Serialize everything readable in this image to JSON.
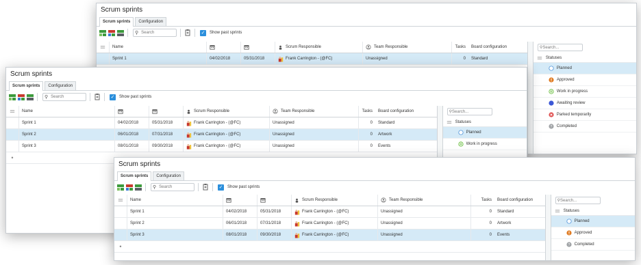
{
  "title": "Scrum sprints",
  "tabs": [
    "Scrum sprints",
    "Configuration"
  ],
  "search_placeholder": "Search",
  "show_past_label": "Show past sprints",
  "columns": {
    "name": "Name",
    "scrum_responsible": "Scrum Responsible",
    "team_responsible": "Team Responsible",
    "tasks": "Tasks",
    "board_configuration": "Board configuration"
  },
  "side": {
    "search_placeholder": "Search...",
    "header": "Statuses"
  },
  "colors": {
    "accent": "#2b8fdc",
    "selection": "#d5eaf7",
    "planned": "#ffffff",
    "approved": "#e07b22",
    "work_in_progress": "#5cb82e",
    "awaiting_review": "#3b57d6",
    "parked_temporarily": "#e05454",
    "completed": "#a0a3a6"
  },
  "windows": [
    {
      "rows": [
        {
          "name": "Sprint 1",
          "start": "04/02/2018",
          "end": "05/31/2018",
          "scrum": "Frank Carrington - (@FC)",
          "team": "Unassigned",
          "tasks": "0",
          "board": "Standard",
          "selected": true
        }
      ],
      "statuses": [
        {
          "label": "Planned",
          "icon": "circle-outline-icon",
          "color": "#ffffff",
          "selected": true
        },
        {
          "label": "Approved",
          "icon": "exclamation-icon",
          "color": "#e07b22"
        },
        {
          "label": "Work in progress",
          "icon": "pause-icon",
          "color": "#5cb82e"
        },
        {
          "label": "Awaiting review",
          "icon": "dot-icon",
          "color": "#3b57d6"
        },
        {
          "label": "Parked temporarily",
          "icon": "cross-icon",
          "color": "#e05454"
        },
        {
          "label": "Completed",
          "icon": "question-icon",
          "color": "#a0a3a6"
        }
      ]
    },
    {
      "rows": [
        {
          "name": "Sprint 1",
          "start": "04/02/2018",
          "end": "05/31/2018",
          "scrum": "Frank Carrington - (@FC)",
          "team": "Unassigned",
          "tasks": "0",
          "board": "Standard"
        },
        {
          "name": "Sprint 2",
          "start": "06/01/2018",
          "end": "07/31/2018",
          "scrum": "Frank Carrington - (@FC)",
          "team": "Unassigned",
          "tasks": "0",
          "board": "Artwork",
          "selected": true
        },
        {
          "name": "Sprint 3",
          "start": "08/01/2018",
          "end": "09/30/2018",
          "scrum": "Frank Carrington - (@FC)",
          "team": "Unassigned",
          "tasks": "0",
          "board": "Events"
        }
      ],
      "statuses": [
        {
          "label": "Planned",
          "icon": "circle-outline-icon",
          "color": "#ffffff",
          "selected": true
        },
        {
          "label": "Work in progress",
          "icon": "pause-icon",
          "color": "#5cb82e"
        }
      ]
    },
    {
      "rows": [
        {
          "name": "Sprint 1",
          "start": "04/02/2018",
          "end": "05/31/2018",
          "scrum": "Frank Carrington - (@FC)",
          "team": "Unassigned",
          "tasks": "0",
          "board": "Standard"
        },
        {
          "name": "Sprint 2",
          "start": "06/01/2018",
          "end": "07/31/2018",
          "scrum": "Frank Carrington - (@FC)",
          "team": "Unassigned",
          "tasks": "0",
          "board": "Artwork"
        },
        {
          "name": "Sprint 3",
          "start": "08/01/2018",
          "end": "09/30/2018",
          "scrum": "Frank Carrington - (@FC)",
          "team": "Unassigned",
          "tasks": "0",
          "board": "Events",
          "selected": true
        }
      ],
      "statuses": [
        {
          "label": "Planned",
          "icon": "circle-outline-icon",
          "color": "#ffffff",
          "selected": true
        },
        {
          "label": "Approved",
          "icon": "exclamation-icon",
          "color": "#e07b22"
        },
        {
          "label": "Completed",
          "icon": "question-icon",
          "color": "#a0a3a6"
        }
      ]
    }
  ]
}
